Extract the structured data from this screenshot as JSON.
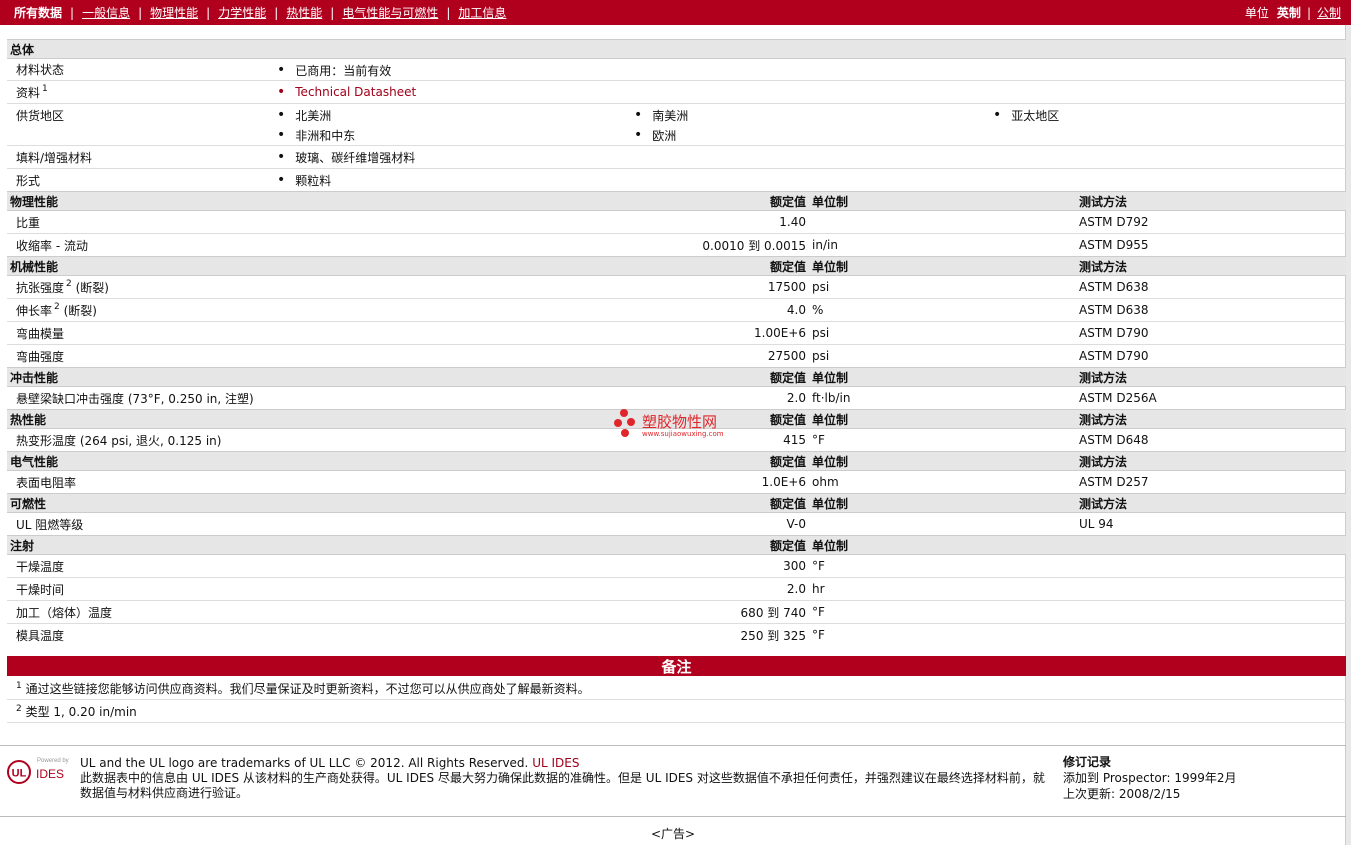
{
  "nav": {
    "items": [
      "所有数据",
      "一般信息",
      "物理性能",
      "力学性能",
      "热性能",
      "电气性能与可燃性",
      "加工信息"
    ],
    "units_label": "单位",
    "unit_english": "英制",
    "unit_metric": "公制"
  },
  "general": {
    "section": "总体",
    "status_label": "材料状态",
    "status_value": "已商用：当前有效",
    "doc_label": "资料",
    "doc_sup": "1",
    "doc_value": "Technical Datasheet",
    "supply_label": "供货地区",
    "supply": [
      "北美洲",
      "南美洲",
      "亚太地区",
      "非洲和中东",
      "欧洲"
    ],
    "filler_label": "填料/增强材料",
    "filler_value": "玻璃、碳纤维增强材料",
    "form_label": "形式",
    "form_value": "颗粒料"
  },
  "headers": {
    "nominal": "额定值",
    "unit": "单位制",
    "method": "测试方法"
  },
  "physical": {
    "section": "物理性能",
    "rows": [
      {
        "name": "比重",
        "value": "1.40",
        "unit": "",
        "method": "ASTM D792"
      },
      {
        "name": "收缩率  - 流动",
        "value": "0.0010 到  0.0015",
        "unit": "in/in",
        "method": "ASTM D955"
      }
    ]
  },
  "mechanical": {
    "section": "机械性能",
    "rows": [
      {
        "name": "抗张强度",
        "sup": "2",
        "suffix": "(断裂)",
        "value": "17500",
        "unit": "psi",
        "method": "ASTM D638"
      },
      {
        "name": "伸长率",
        "sup": "2",
        "suffix": "(断裂)",
        "value": "4.0",
        "unit": "%",
        "method": "ASTM D638"
      },
      {
        "name": "弯曲模量",
        "value": "1.00E+6",
        "unit": "psi",
        "method": "ASTM D790"
      },
      {
        "name": "弯曲强度",
        "value": "27500",
        "unit": "psi",
        "method": "ASTM D790"
      }
    ]
  },
  "impact": {
    "section": "冲击性能",
    "rows": [
      {
        "name": "悬壁梁缺口冲击强度  (73°F, 0.250 in, 注塑)",
        "value": "2.0",
        "unit": "ft·lb/in",
        "method": "ASTM D256A"
      }
    ]
  },
  "thermal": {
    "section": "热性能",
    "rows": [
      {
        "name": "热变形温度  (264 psi, 退火, 0.125 in)",
        "value": "415",
        "unit": "°F",
        "method": "ASTM D648"
      }
    ]
  },
  "electrical": {
    "section": "电气性能",
    "rows": [
      {
        "name": "表面电阻率",
        "value": "1.0E+6",
        "unit": "ohm",
        "method": "ASTM D257"
      }
    ]
  },
  "flammability": {
    "section": "可燃性",
    "rows": [
      {
        "name": "UL 阻燃等级",
        "value": "V-0",
        "unit": "",
        "method": "UL 94"
      }
    ]
  },
  "injection": {
    "section": "注射",
    "rows": [
      {
        "name": "干燥温度",
        "value": "300",
        "unit": "°F"
      },
      {
        "name": "干燥时间",
        "value": "2.0",
        "unit": "hr"
      },
      {
        "name": "加工（熔体）温度",
        "value": "680 到  740",
        "unit": "°F"
      },
      {
        "name": "模具温度",
        "value": "250 到  325",
        "unit": "°F"
      }
    ]
  },
  "notes": {
    "title": "备注",
    "items": [
      {
        "sup": "1",
        "text": "通过这些链接您能够访问供应商资料。我们尽量保证及时更新资料，不过您可以从供应商处了解最新资料。"
      },
      {
        "sup": "2",
        "text": "类型  1, 0.20 in/min"
      }
    ]
  },
  "footer": {
    "logo_powered": "Powered by",
    "logo_ul": "UL",
    "logo_ides": "IDES",
    "trademark": "UL and the UL logo are trademarks of UL LLC © 2012. All Rights Reserved.",
    "ul_ides_link": "UL IDES",
    "disclaimer": "此数据表中的信息由  UL IDES 从该材料的生产商处获得。UL IDES 尽最大努力确保此数据的准确性。但是  UL IDES 对这些数据值不承担任何责任，并强烈建议在最终选择材料前，就数据值与材料供应商进行验证。",
    "rev_title": "修订记录",
    "rev_added": "添加到  Prospector:    1999年2月",
    "rev_updated": "上次更新:     2008/2/15",
    "ad": "<广告>"
  },
  "watermark": {
    "title": "塑胶物性网",
    "url": "www.sujiaowuxing.com"
  }
}
